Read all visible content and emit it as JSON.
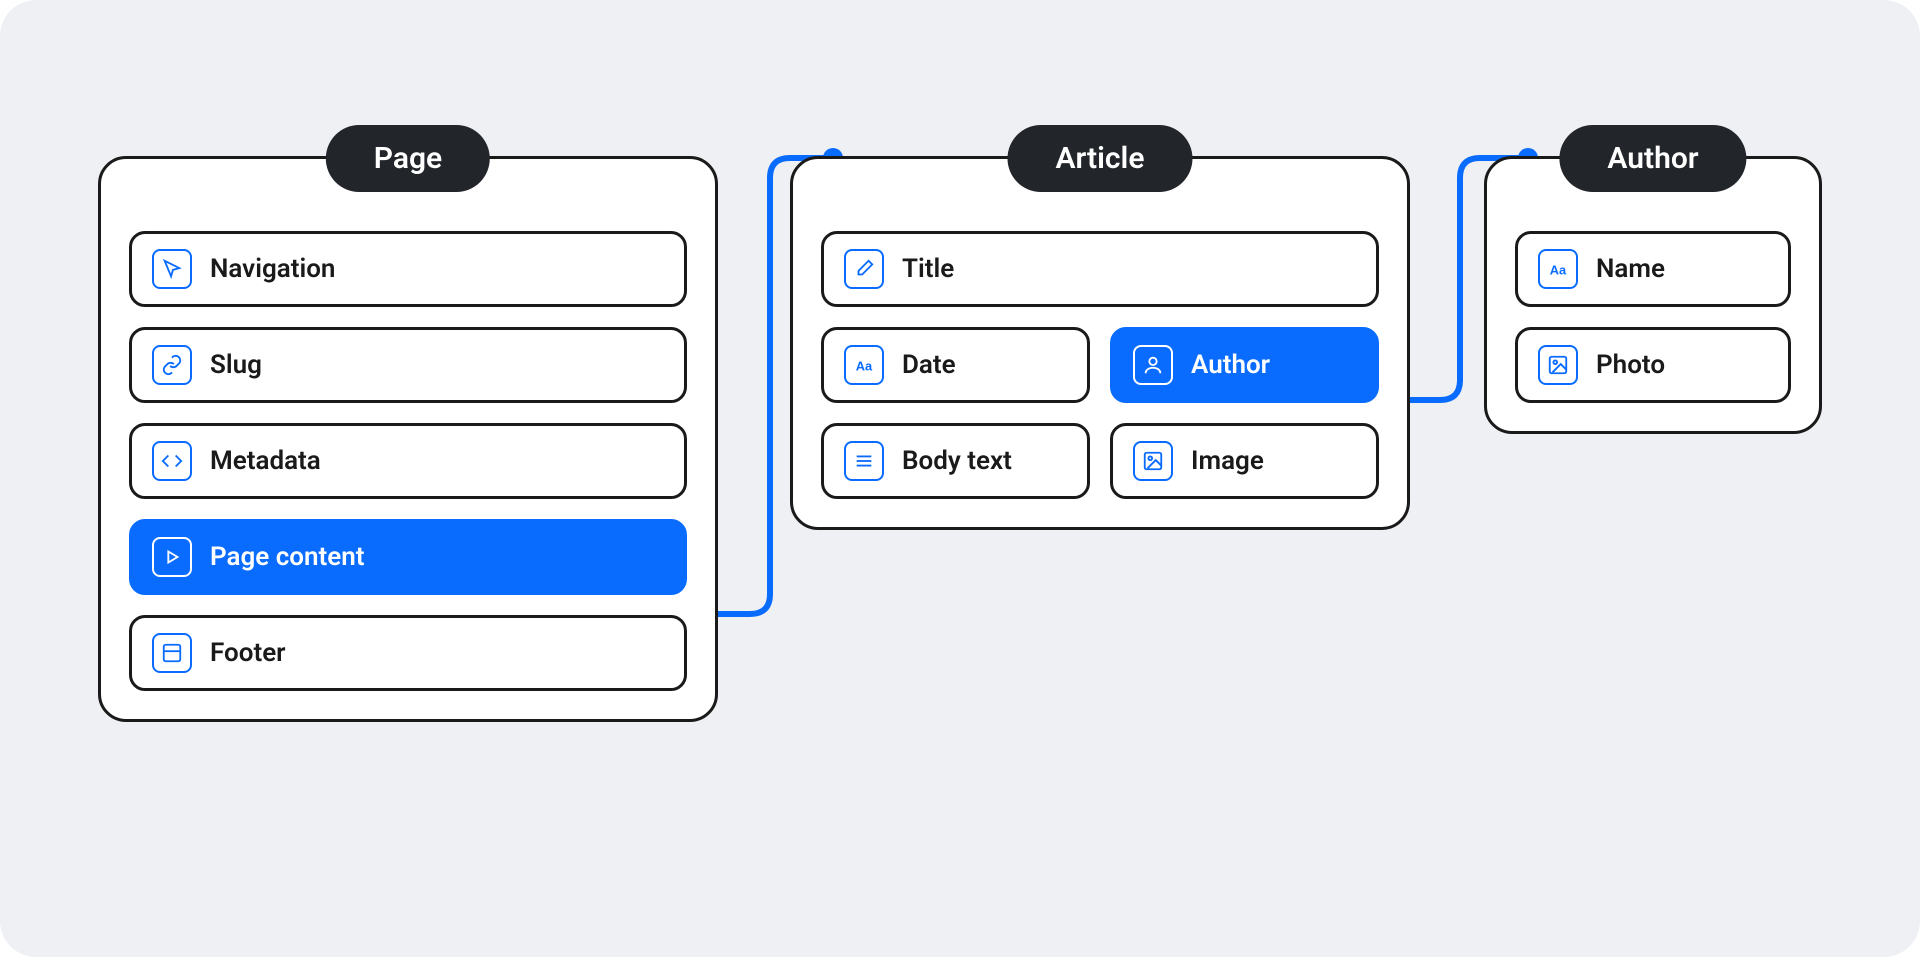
{
  "colors": {
    "accent": "#0a6cff",
    "panel_border": "#1a1a1a",
    "header_bg": "#22252a",
    "canvas_bg": "#eef0f4"
  },
  "panels": {
    "page": {
      "title": "Page",
      "fields": {
        "navigation": {
          "label": "Navigation",
          "icon": "cursor-icon",
          "active": false
        },
        "slug": {
          "label": "Slug",
          "icon": "link-icon",
          "active": false
        },
        "metadata": {
          "label": "Metadata",
          "icon": "code-icon",
          "active": false
        },
        "page_content": {
          "label": "Page content",
          "icon": "play-icon",
          "active": true
        },
        "footer": {
          "label": "Footer",
          "icon": "layout-icon",
          "active": false
        }
      }
    },
    "article": {
      "title": "Article",
      "fields": {
        "title": {
          "label": "Title",
          "icon": "pencil-icon",
          "active": false
        },
        "date": {
          "label": "Date",
          "icon": "text-aa-icon",
          "active": false
        },
        "author": {
          "label": "Author",
          "icon": "user-icon",
          "active": true
        },
        "body_text": {
          "label": "Body text",
          "icon": "lines-icon",
          "active": false
        },
        "image": {
          "label": "Image",
          "icon": "image-icon",
          "active": false
        }
      }
    },
    "author": {
      "title": "Author",
      "fields": {
        "name": {
          "label": "Name",
          "icon": "text-aa-icon",
          "active": false
        },
        "photo": {
          "label": "Photo",
          "icon": "image-icon",
          "active": false
        }
      }
    }
  },
  "connections": [
    {
      "from": "page.page_content",
      "to": "article"
    },
    {
      "from": "article.author",
      "to": "author"
    }
  ]
}
